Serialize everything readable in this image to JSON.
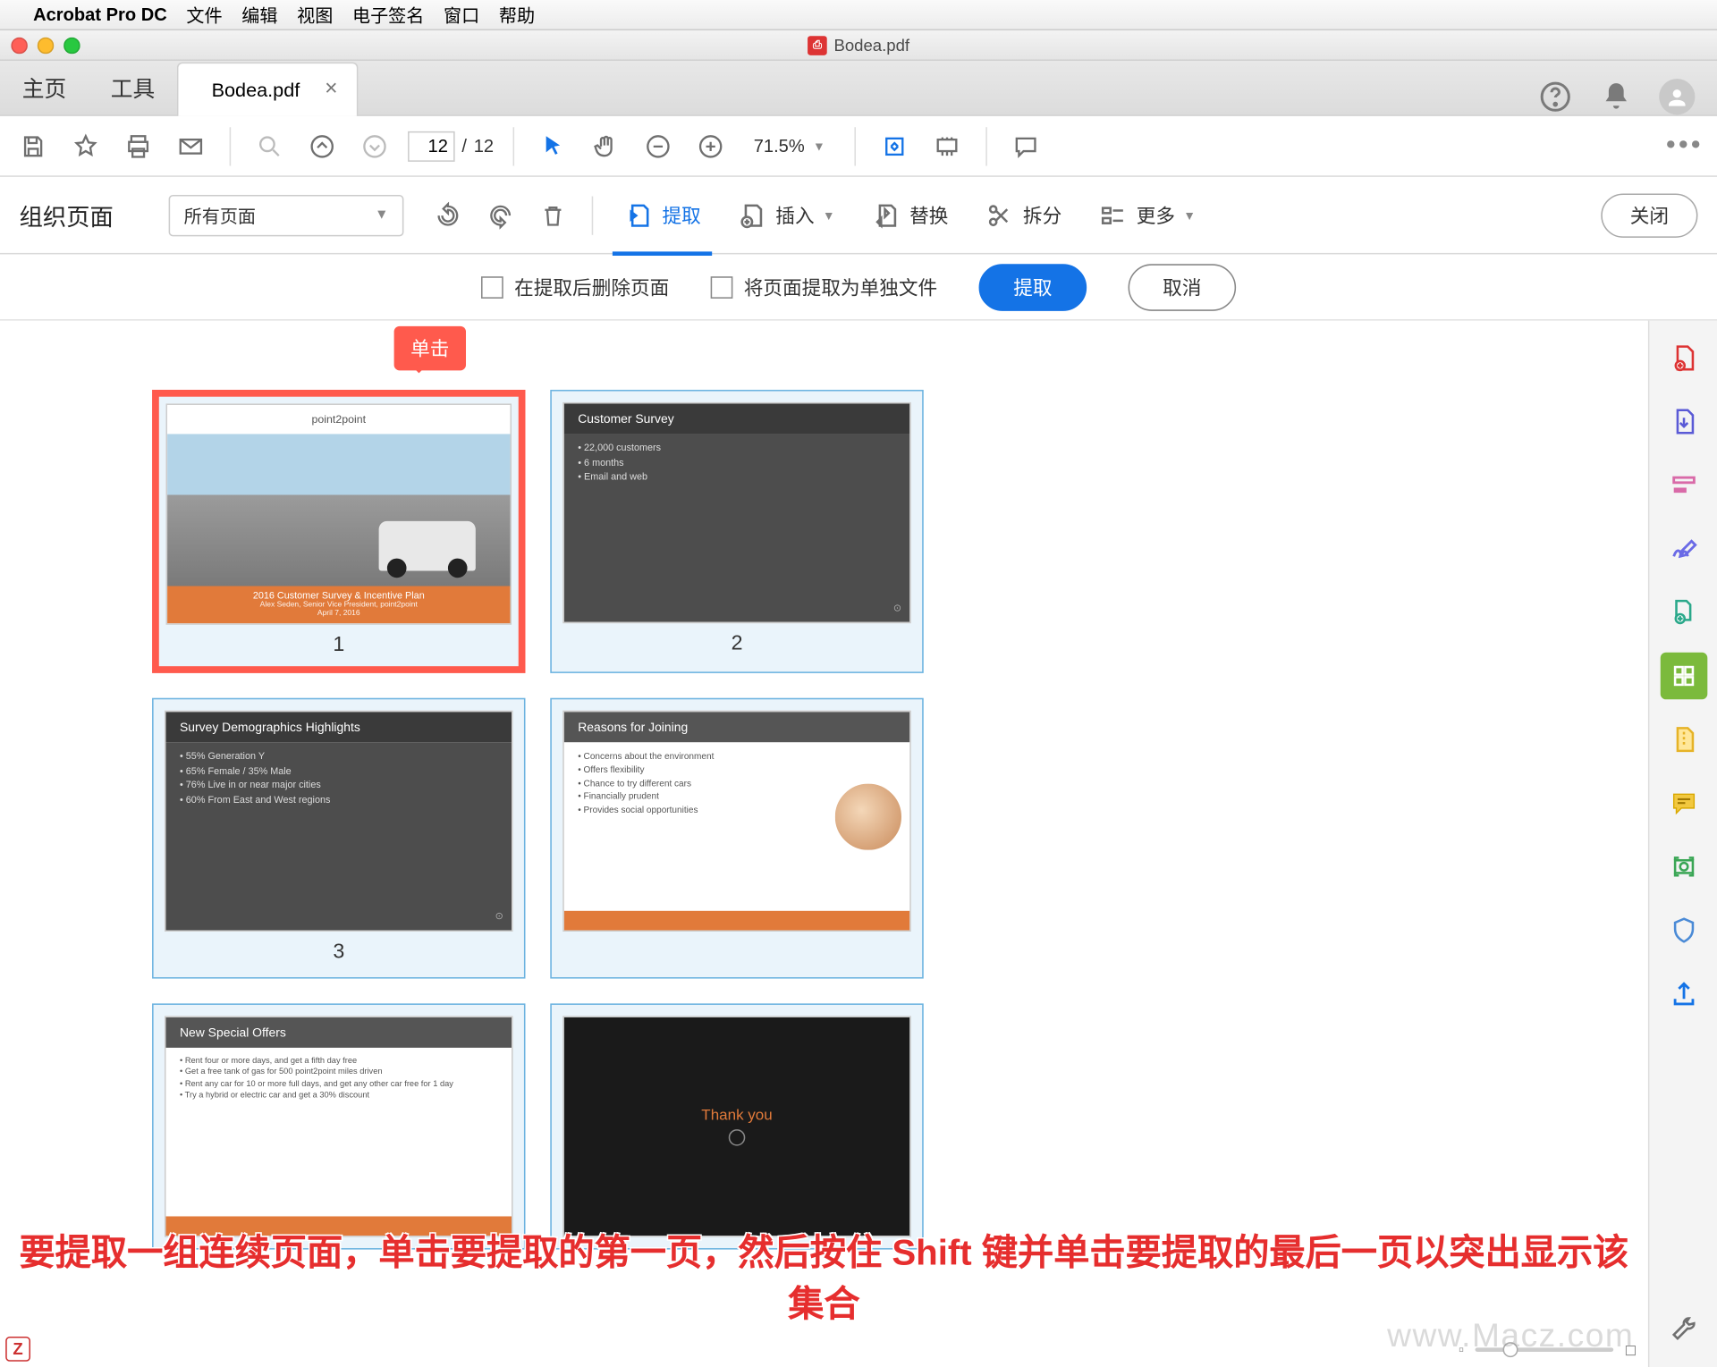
{
  "mac_menu": {
    "app": "Acrobat Pro DC",
    "items": [
      "文件",
      "编辑",
      "视图",
      "电子签名",
      "窗口",
      "帮助"
    ]
  },
  "window": {
    "title": "Bodea.pdf"
  },
  "tabs": {
    "home": "主页",
    "tools": "工具",
    "doc": "Bodea.pdf"
  },
  "toolbar": {
    "page_current": "12",
    "page_sep": "/",
    "page_total": "12",
    "zoom": "71.5%"
  },
  "organize": {
    "title": "组织页面",
    "filter": "所有页面",
    "actions": {
      "extract": "提取",
      "insert": "插入",
      "replace": "替换",
      "split": "拆分",
      "more": "更多"
    },
    "close": "关闭"
  },
  "extract_bar": {
    "delete_after": "在提取后删除页面",
    "as_separate": "将页面提取为单独文件",
    "extract": "提取",
    "cancel": "取消"
  },
  "thumbs": {
    "callout": "单击",
    "p1": {
      "num": "1",
      "logo": "point2point",
      "title": "2016 Customer Survey & Incentive Plan",
      "sub": "Alex Seden, Senior Vice President, point2point",
      "date": "April 7, 2016"
    },
    "p2": {
      "num": "2",
      "title": "Customer Survey",
      "b1": "22,000 customers",
      "b2": "6 months",
      "b3": "Email and web"
    },
    "p3": {
      "num": "3",
      "title": "Survey Demographics Highlights",
      "b1": "55% Generation Y",
      "b2": "65% Female / 35% Male",
      "b3": "76% Live in or near major cities",
      "b4": "60% From East and West regions"
    },
    "p4": {
      "title": "Reasons for Joining",
      "b1": "Concerns about the environment",
      "b2": "Offers flexibility",
      "b3": "Chance to try different cars",
      "b4": "Financially prudent",
      "b5": "Provides social opportunities"
    },
    "p5": {
      "title": "New Special Offers",
      "b1": "Rent four or more days, and get a fifth day free",
      "b2": "Get a free tank of gas for 500 point2point miles driven",
      "b3": "Rent any car for 10 or more full days, and get any other car free for 1 day",
      "b4": "Try a hybrid or electric car and get a 30% discount"
    },
    "p6": {
      "thank": "Thank you"
    }
  },
  "instruction": "要提取一组连续页面，单击要提取的第一页，然后按住 Shift 键并单击要提取的最后一页以突出显示该集合",
  "watermark": "www.Macz.com"
}
